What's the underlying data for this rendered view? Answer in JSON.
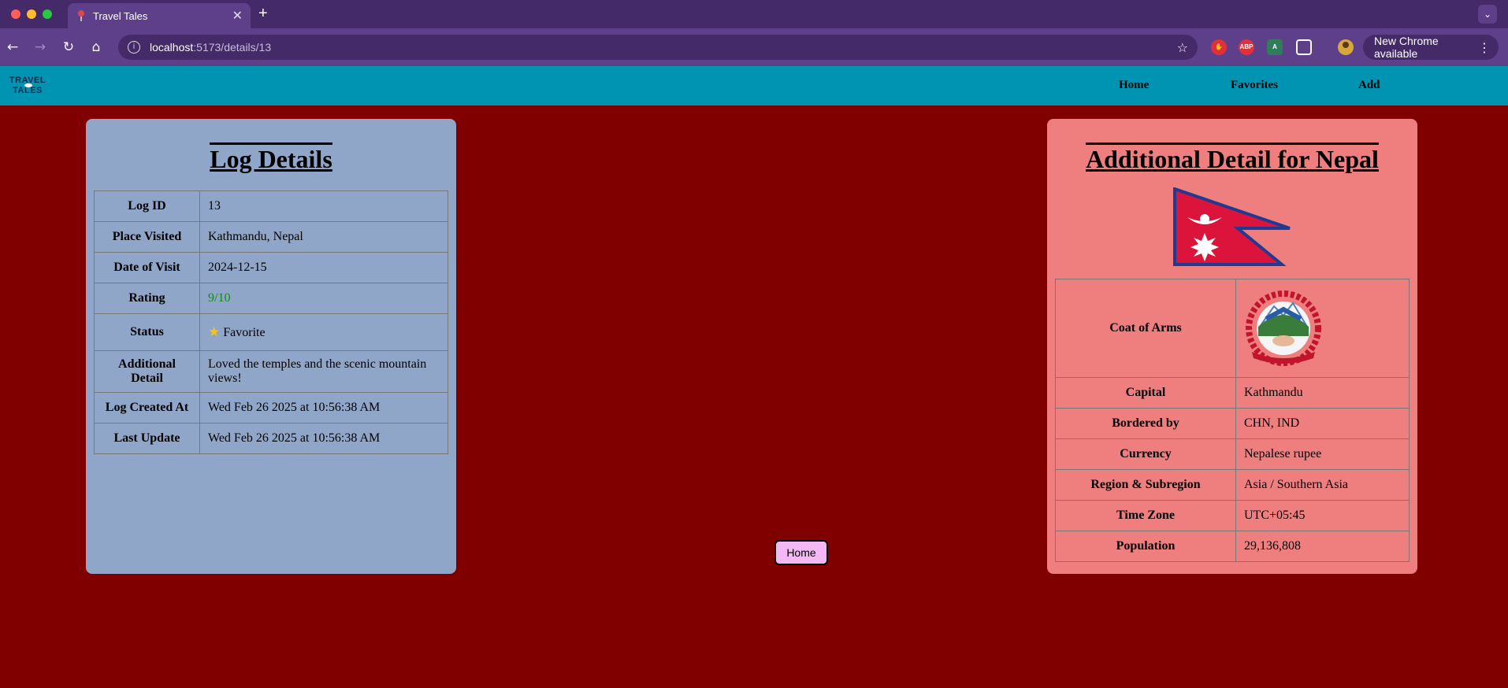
{
  "browser": {
    "tab_title": "Travel Tales",
    "url_host": "localhost",
    "url_path": ":5173/details/13",
    "update_label": "New Chrome available",
    "ext_abp": "ABP"
  },
  "site": {
    "logo_line1": "TRAVEL",
    "logo_line2": "TALES",
    "nav": [
      "Home",
      "Favorites",
      "Add"
    ]
  },
  "log": {
    "title": "Log Details",
    "rows": [
      {
        "k": "Log ID",
        "v": "13"
      },
      {
        "k": "Place Visited",
        "v": "Kathmandu, Nepal"
      },
      {
        "k": "Date of Visit",
        "v": "2024-12-15"
      },
      {
        "k": "Rating",
        "v": "9/10"
      },
      {
        "k": "Status",
        "v": "Favorite"
      },
      {
        "k": "Additional Detail",
        "v": "Loved the temples and the scenic mountain views!"
      },
      {
        "k": "Log Created At",
        "v": "Wed Feb 26 2025 at 10:56:38 AM"
      },
      {
        "k": "Last Update",
        "v": "Wed Feb 26 2025 at 10:56:38 AM"
      }
    ]
  },
  "country": {
    "title": "Additional Detail for Nepal",
    "rows": [
      {
        "k": "Coat of Arms",
        "v": ""
      },
      {
        "k": "Capital",
        "v": "Kathmandu"
      },
      {
        "k": "Bordered by",
        "v": "CHN, IND"
      },
      {
        "k": "Currency",
        "v": "Nepalese rupee"
      },
      {
        "k": "Region & Subregion",
        "v": "Asia / Southern Asia"
      },
      {
        "k": "Time Zone",
        "v": "UTC+05:45"
      },
      {
        "k": "Population",
        "v": "29,136,808"
      }
    ]
  },
  "home_button": "Home",
  "colors": {
    "page_bg": "#800000",
    "nav_bg": "#0094b2",
    "log_card": "#8fa6c8",
    "country_card": "#ef7f7f",
    "rating": "#168a16",
    "home_button": "#f4b8f4"
  }
}
